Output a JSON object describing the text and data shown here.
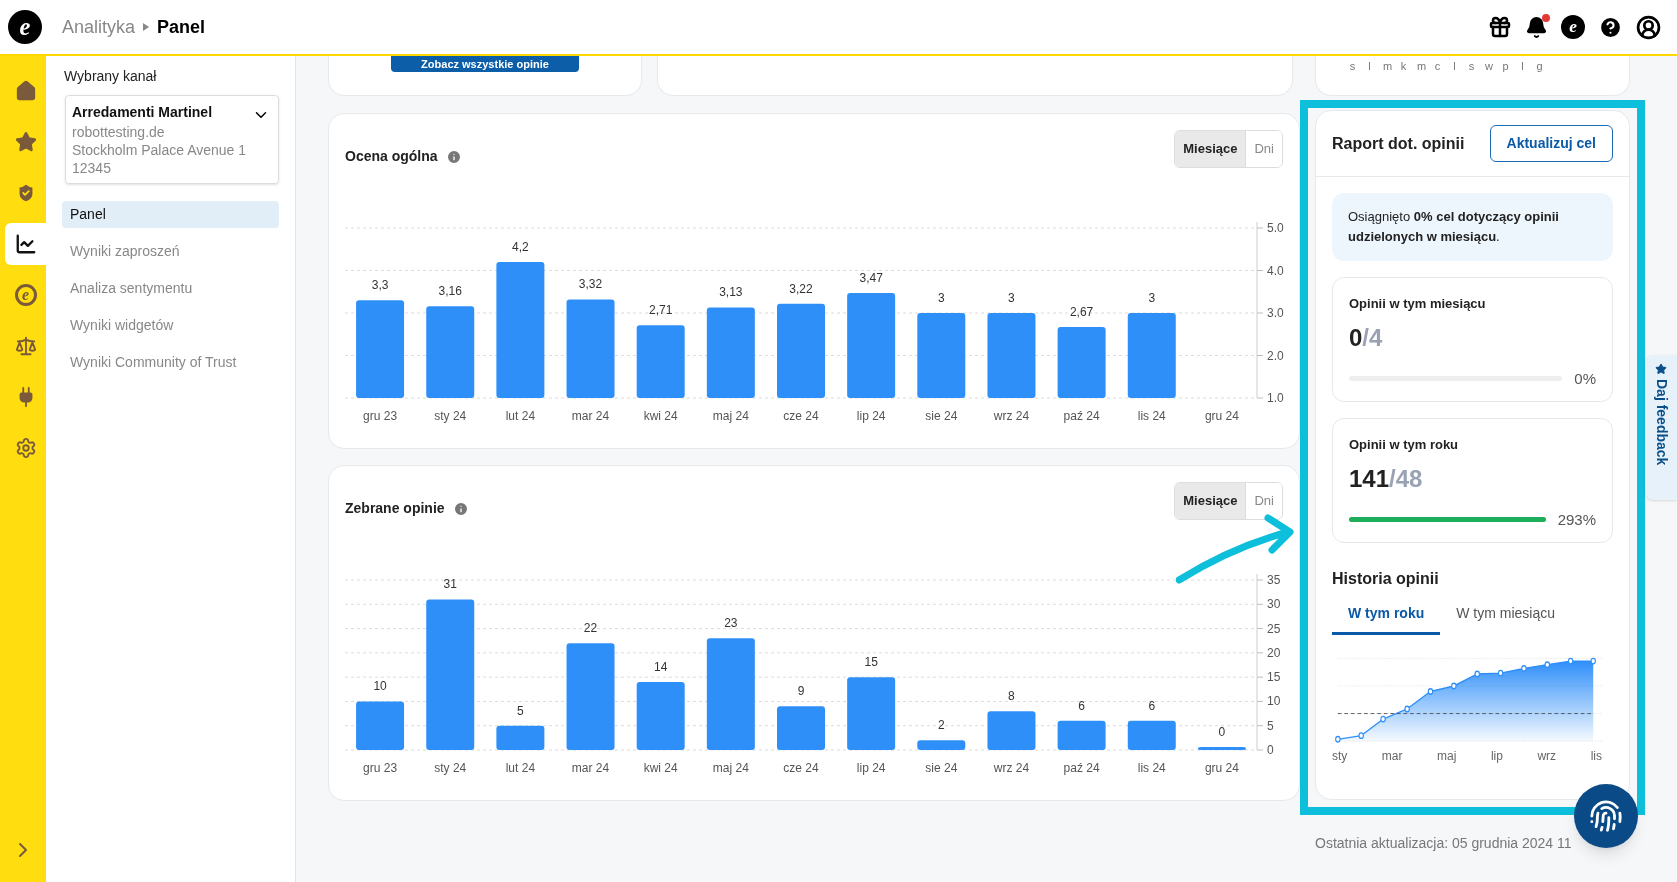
{
  "header": {
    "logo_letter": "e",
    "breadcrumb": [
      "Analityka",
      "Panel"
    ],
    "actions": [
      {
        "kind": "gift"
      },
      {
        "kind": "bell",
        "badge": true
      },
      {
        "kind": "brand",
        "letter": "e"
      },
      {
        "kind": "help"
      },
      {
        "kind": "user"
      }
    ]
  },
  "rail": {
    "items": [
      {
        "kind": "home",
        "selected": false
      },
      {
        "kind": "star",
        "selected": false
      },
      {
        "kind": "shield",
        "selected": false
      },
      {
        "kind": "chart",
        "selected": true
      },
      {
        "kind": "brand",
        "letter": "e",
        "selected": false
      },
      {
        "kind": "scale",
        "selected": false
      },
      {
        "kind": "plug",
        "selected": false
      },
      {
        "kind": "settings",
        "selected": false
      }
    ]
  },
  "sidebar": {
    "channel_label": "Wybrany kanał",
    "channel": {
      "name": "Arredamenti Martinel",
      "lines": [
        "robottesting.de",
        "Stockholm Palace Avenue 1",
        "12345"
      ]
    },
    "items": [
      {
        "label": "Panel",
        "selected": true
      },
      {
        "label": "Wyniki zaproszeń",
        "selected": false
      },
      {
        "label": "Analiza sentymentu",
        "selected": false
      },
      {
        "label": "Wyniki widgetów",
        "selected": false
      },
      {
        "label": "Wyniki Community of Trust",
        "selected": false
      }
    ]
  },
  "top_cards": {
    "button": "Zobacz wszystkie opinie",
    "letters": [
      "s",
      "l",
      "m",
      "k",
      "m",
      "c",
      "l",
      "s",
      "w",
      "p",
      "l",
      "g"
    ]
  },
  "charts": [
    {
      "title": "Ocena ogólna",
      "toggle": [
        {
          "label": "Miesiące",
          "selected": true
        },
        {
          "label": "Dni",
          "selected": false
        }
      ],
      "chart_data": {
        "type": "bar",
        "categories": [
          "gru 23",
          "sty 24",
          "lut 24",
          "mar 24",
          "kwi 24",
          "maj 24",
          "cze 24",
          "lip 24",
          "sie 24",
          "wrz 24",
          "paź 24",
          "lis 24",
          "gru 24"
        ],
        "values": [
          3.3,
          3.16,
          4.2,
          3.32,
          2.71,
          3.13,
          3.22,
          3.47,
          3,
          3,
          2.67,
          3,
          null
        ],
        "value_labels": [
          "3,3",
          "3,16",
          "4,2",
          "3,32",
          "2,71",
          "3,13",
          "3,22",
          "3,47",
          "3",
          "3",
          "2,67",
          "3",
          null
        ],
        "ylim": [
          1,
          5
        ],
        "grid": true,
        "yticks": [
          {
            "value": 1,
            "label": "1.0"
          },
          {
            "value": 2,
            "label": "2.0"
          },
          {
            "value": 3,
            "label": "3.0"
          },
          {
            "value": 4,
            "label": "4.0"
          },
          {
            "value": 5,
            "label": "5.0"
          }
        ]
      }
    },
    {
      "title": "Zebrane opinie",
      "toggle": [
        {
          "label": "Miesiące",
          "selected": true
        },
        {
          "label": "Dni",
          "selected": false
        }
      ],
      "chart_data": {
        "type": "bar",
        "categories": [
          "gru 23",
          "sty 24",
          "lut 24",
          "mar 24",
          "kwi 24",
          "maj 24",
          "cze 24",
          "lip 24",
          "sie 24",
          "wrz 24",
          "paź 24",
          "lis 24",
          "gru 24"
        ],
        "values": [
          10,
          31,
          5,
          22,
          14,
          23,
          9,
          15,
          2,
          8,
          6,
          6,
          0
        ],
        "value_labels": [
          "10",
          "31",
          "5",
          "22",
          "14",
          "23",
          "9",
          "15",
          "2",
          "8",
          "6",
          "6",
          "0"
        ],
        "ylim": [
          0,
          35
        ],
        "grid": true,
        "yticks": [
          0,
          5,
          10,
          15,
          20,
          25,
          30,
          35
        ]
      }
    }
  ],
  "report": {
    "title": "Raport dot. opinii",
    "button": "Aktualizuj cel",
    "notice": "Osiągnięto **0% cel dotyczący opinii udzielonych w miesiącu**.",
    "stats": [
      {
        "title": "Opinii w tym miesiącu",
        "value": "0",
        "target": "/4",
        "level": 0,
        "percent": "0%"
      },
      {
        "title": "Opinii w tym roku",
        "value": "141",
        "target": "/48",
        "level": 1,
        "percent": "293%"
      }
    ],
    "history": {
      "title": "Historia opinii",
      "tabs": [
        {
          "label": "W tym roku",
          "selected": true
        },
        {
          "label": "W tym miesiącu",
          "selected": false
        }
      ],
      "x_labels": [
        "sty",
        "mar",
        "maj",
        "lip",
        "wrz",
        "lis"
      ]
    }
  },
  "footer": "Ostatnia aktualizacja: 05 grudnia 2024 11",
  "feedback_tab": "Daj feedback"
}
